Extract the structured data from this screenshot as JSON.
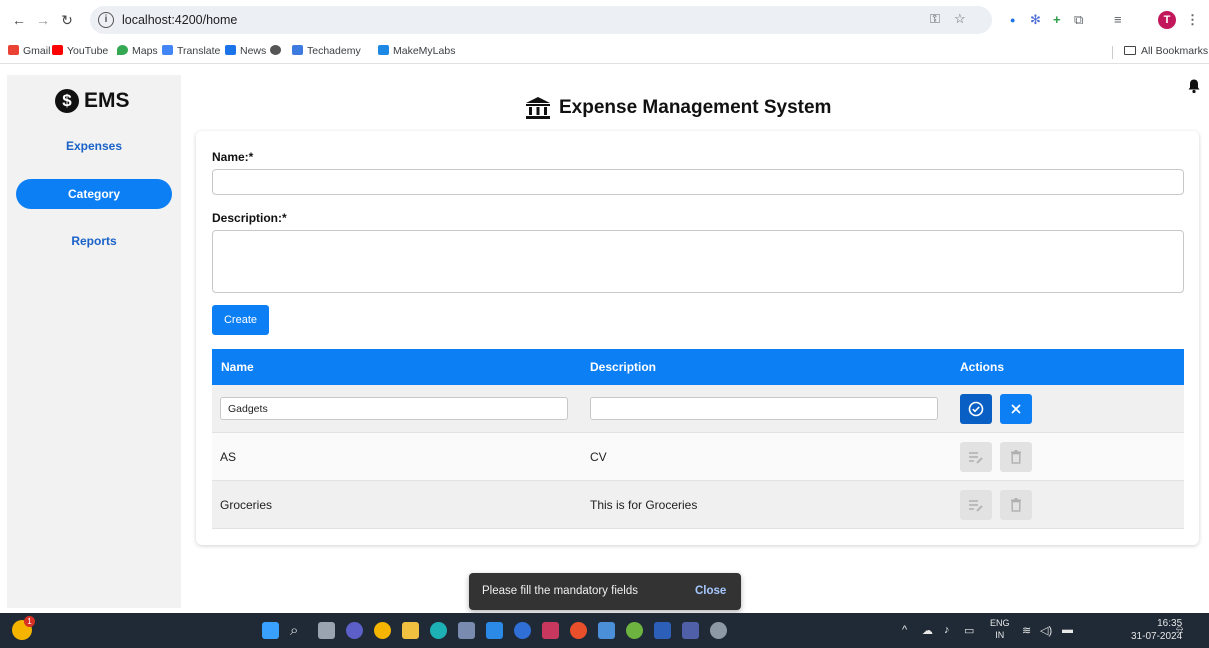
{
  "browser": {
    "url": "localhost:4200/home",
    "profile_initial": "T",
    "bookmarks": [
      "Gmail",
      "YouTube",
      "Maps",
      "Translate",
      "News",
      "Techademy",
      "MakeMyLabs"
    ],
    "all_bookmarks": "All Bookmarks"
  },
  "sidebar": {
    "logo_text": "EMS",
    "logo_symbol": "$",
    "items": [
      {
        "label": "Expenses",
        "active": false
      },
      {
        "label": "Category",
        "active": true
      },
      {
        "label": "Reports",
        "active": false
      }
    ]
  },
  "header": {
    "title": "Expense Management System"
  },
  "form": {
    "name_label": "Name:*",
    "name_value": "",
    "description_label": "Description:*",
    "description_value": "",
    "create_label": "Create"
  },
  "table": {
    "headers": [
      "Name",
      "Description",
      "Actions"
    ],
    "edit_row": {
      "name": "Gadgets",
      "description": ""
    },
    "rows": [
      {
        "name": "AS",
        "description": "CV"
      },
      {
        "name": "Groceries",
        "description": "This is for Groceries"
      }
    ]
  },
  "snackbar": {
    "message": "Please fill the mandatory fields",
    "action": "Close"
  },
  "taskbar": {
    "notification_count": "1",
    "language": "ENG",
    "region": "IN",
    "time": "16:35",
    "date": "31-07-2024"
  },
  "colors": {
    "primary": "#0d7ff5",
    "save": "#0a5fc4",
    "sidebar_bg": "#f2f2f2"
  }
}
